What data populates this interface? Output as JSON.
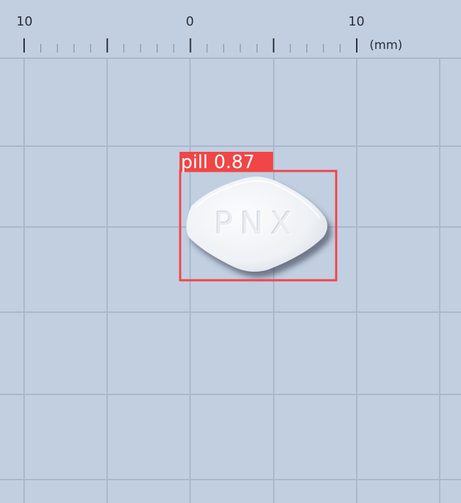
{
  "ruler": {
    "labels": [
      "10",
      "0",
      "10"
    ],
    "unit": "(mm)"
  },
  "detection": {
    "class_name": "pill",
    "confidence": "0.87",
    "label_text": "pill  0.87",
    "box_color": "#f04646"
  },
  "pill": {
    "imprint": "PNX",
    "color": "#f3f5f7",
    "shape": "diamond"
  },
  "colors": {
    "background": "#c2cfe1",
    "grid_major": "#a9b8cc"
  }
}
